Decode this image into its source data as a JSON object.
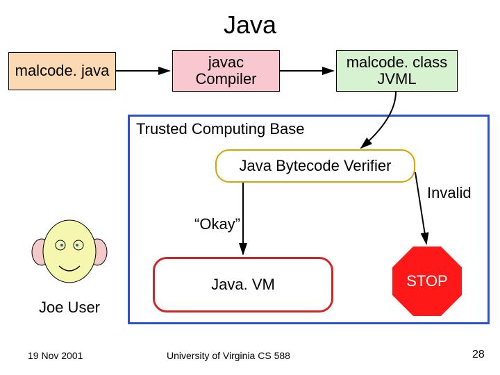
{
  "title": "Java",
  "boxes": {
    "source": "malcode. java",
    "compiler_line1": "javac",
    "compiler_line2": "Compiler",
    "classfile_line1": "malcode. class",
    "classfile_line2": "JVML"
  },
  "tcb_label": "Trusted Computing Base",
  "verifier": "Java Bytecode Verifier",
  "okay": "“Okay”",
  "invalid": "Invalid",
  "javavm": "Java. VM",
  "stop": "STOP",
  "joeuser": "Joe User",
  "footer": {
    "date": "19 Nov 2001",
    "center": "University of Virginia CS 588",
    "page": "28"
  }
}
